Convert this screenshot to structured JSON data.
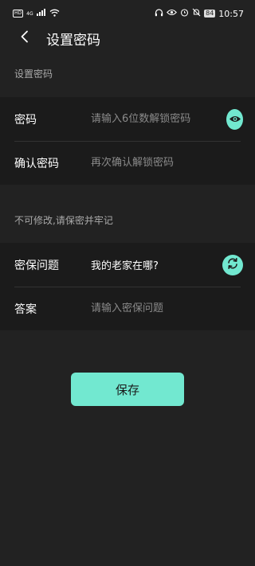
{
  "status_bar": {
    "hd": "HD",
    "signal_type": "4G",
    "battery": "84",
    "time": "10:57"
  },
  "header": {
    "title": "设置密码"
  },
  "password_section": {
    "hint": "设置密码",
    "password_label": "密码",
    "password_placeholder": "请输入6位数解锁密码",
    "confirm_label": "确认密码",
    "confirm_placeholder": "再次确认解锁密码"
  },
  "security_section": {
    "hint": "不可修改,请保密并牢记",
    "question_label": "密保问题",
    "question_value": "我的老家在哪?",
    "answer_label": "答案",
    "answer_placeholder": "请输入密保问题"
  },
  "actions": {
    "save_label": "保存"
  },
  "colors": {
    "background": "#222222",
    "group_background": "#1b1b1b",
    "accent": "#72e8d0"
  }
}
